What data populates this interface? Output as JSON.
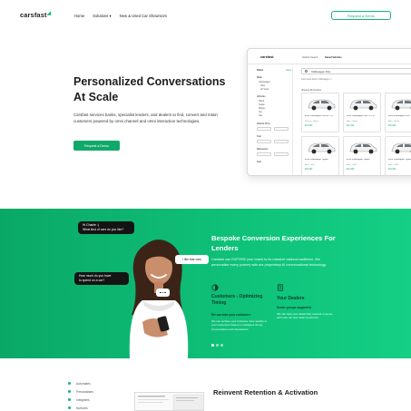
{
  "nav": {
    "logo": "carsfast",
    "links": [
      "Home",
      "Solutions ▾",
      "New & Used Car Showroom"
    ],
    "demo_button": "Request a Demo"
  },
  "hero": {
    "title": "Personalized Conversations At Scale",
    "description": "Carsfast services banks, specialist lenders, and dealers to find, convert and retain customers powered by omni channel and omni interaction technologies.",
    "cta": "Request a Demo"
  },
  "mockup": {
    "logo": "carsfast",
    "tabs": [
      "Vehicle Search",
      "Saved Vehicles"
    ],
    "sidebar": {
      "filters_label": "Filters",
      "reset_label": "Reset",
      "make_label": "Make",
      "make_options": [
        "Volkswagen",
        "Vans",
        "All Years"
      ],
      "body_label": "Vehicles",
      "body_options": [
        "Hatch",
        "Sedan",
        "Wagon",
        "Ute",
        "Van"
      ],
      "price_label": "Vehicle Price",
      "year_label": "Year",
      "km_label": "Kilometres",
      "more_label": "Fuel"
    },
    "search_value": "Volkswagen Polo",
    "filter_chips": "New   Used   Demo   Volkswagen ×",
    "result_count": "Showing 89 Vehicles",
    "cars": [
      {
        "name": "2018 Volkswagen Polo 85 TSI",
        "meta": "Manual · Hatch",
        "price": "$19,990"
      },
      {
        "name": "2019 Volkswagen Polo 70 TSI",
        "meta": "Auto · Hatch",
        "price": "$21,490"
      },
      {
        "name": "2020 Volkswagen Polo",
        "meta": "Auto · Hatch",
        "price": "$22,990"
      },
      {
        "name": "2018 Volkswagen Tiguan",
        "meta": "Auto · SUV",
        "price": "$29,990"
      },
      {
        "name": "2019 Volkswagen Tiguan",
        "meta": "Auto · SUV",
        "price": "$31,990"
      },
      {
        "name": "2020 Volkswagen Tiguan",
        "meta": "Auto · SUV",
        "price": "$34,990"
      }
    ]
  },
  "band": {
    "bubble_top": "Hi Charlie :)\nWhat kind of cars do you like?",
    "bubble_right": "I like fast cars",
    "bubble_left": "How much do you have\nto spend on a car?",
    "title": "Bespoke Conversion Experiences For Lenders",
    "description": "Carsfast can EXPOSE your brand to its massive national audience. We personalise every journey with our proprietary AI conversational technology.",
    "features": [
      {
        "icon": "half-circle-icon",
        "title": "Customers - Optimizing Timing",
        "subtitle": "We can take your customers",
        "description": "We can surface your business more quickly to your customers based on intelligent timing, conversations and interactions."
      },
      {
        "icon": "dealer-icon",
        "title": "Your Dealers",
        "subtitle": "Dealer groups supported",
        "description": "We can help your dealership network or group sell more car and retain customers."
      }
    ]
  },
  "bottom": {
    "list": [
      "Automates",
      "Personalises",
      "Integrates",
      "Nurtures"
    ],
    "title": "Reinvent Retention & Activation"
  },
  "colors": {
    "brand_green": "#13b575",
    "band_start": "#0aa866",
    "band_end": "#14cf85",
    "bubble_dark": "#141414"
  }
}
